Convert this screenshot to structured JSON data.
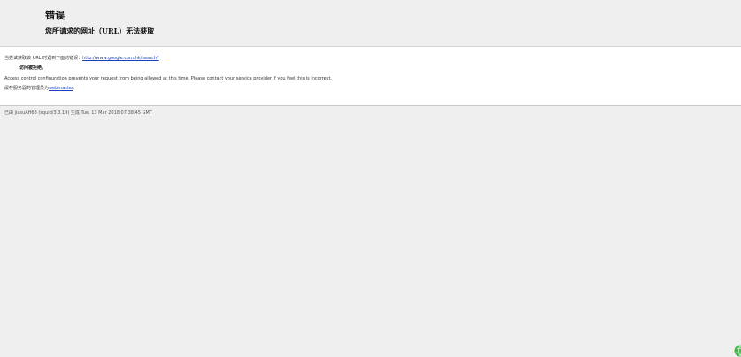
{
  "header": {
    "title": "错误",
    "subtitle": "您所请求的网址（URL）无法获取"
  },
  "content": {
    "retrieval_prefix": "当尝试获取该 URL 时遇到下面的错误：",
    "requested_url": "http://www.google.com.hk/search?",
    "access_denied": "访问被拒绝。",
    "description": "Access control configuration prevents your request from being allowed at this time. Please contact your service provider if you feel this is incorrect.",
    "cache_admin_prefix": "缓存服务器的管理员为",
    "admin_link": "webmaster",
    "admin_suffix": "."
  },
  "footer": {
    "text": "已由 jiasuAH68 (squid/3.3.19) 生成 Tue, 13 Mar 2018 07:38:45 GMT"
  },
  "colors": {
    "background": "#efefef",
    "content_background": "#ffffff",
    "link": "#1b3fbf",
    "corner_icon": "#45b54b"
  }
}
